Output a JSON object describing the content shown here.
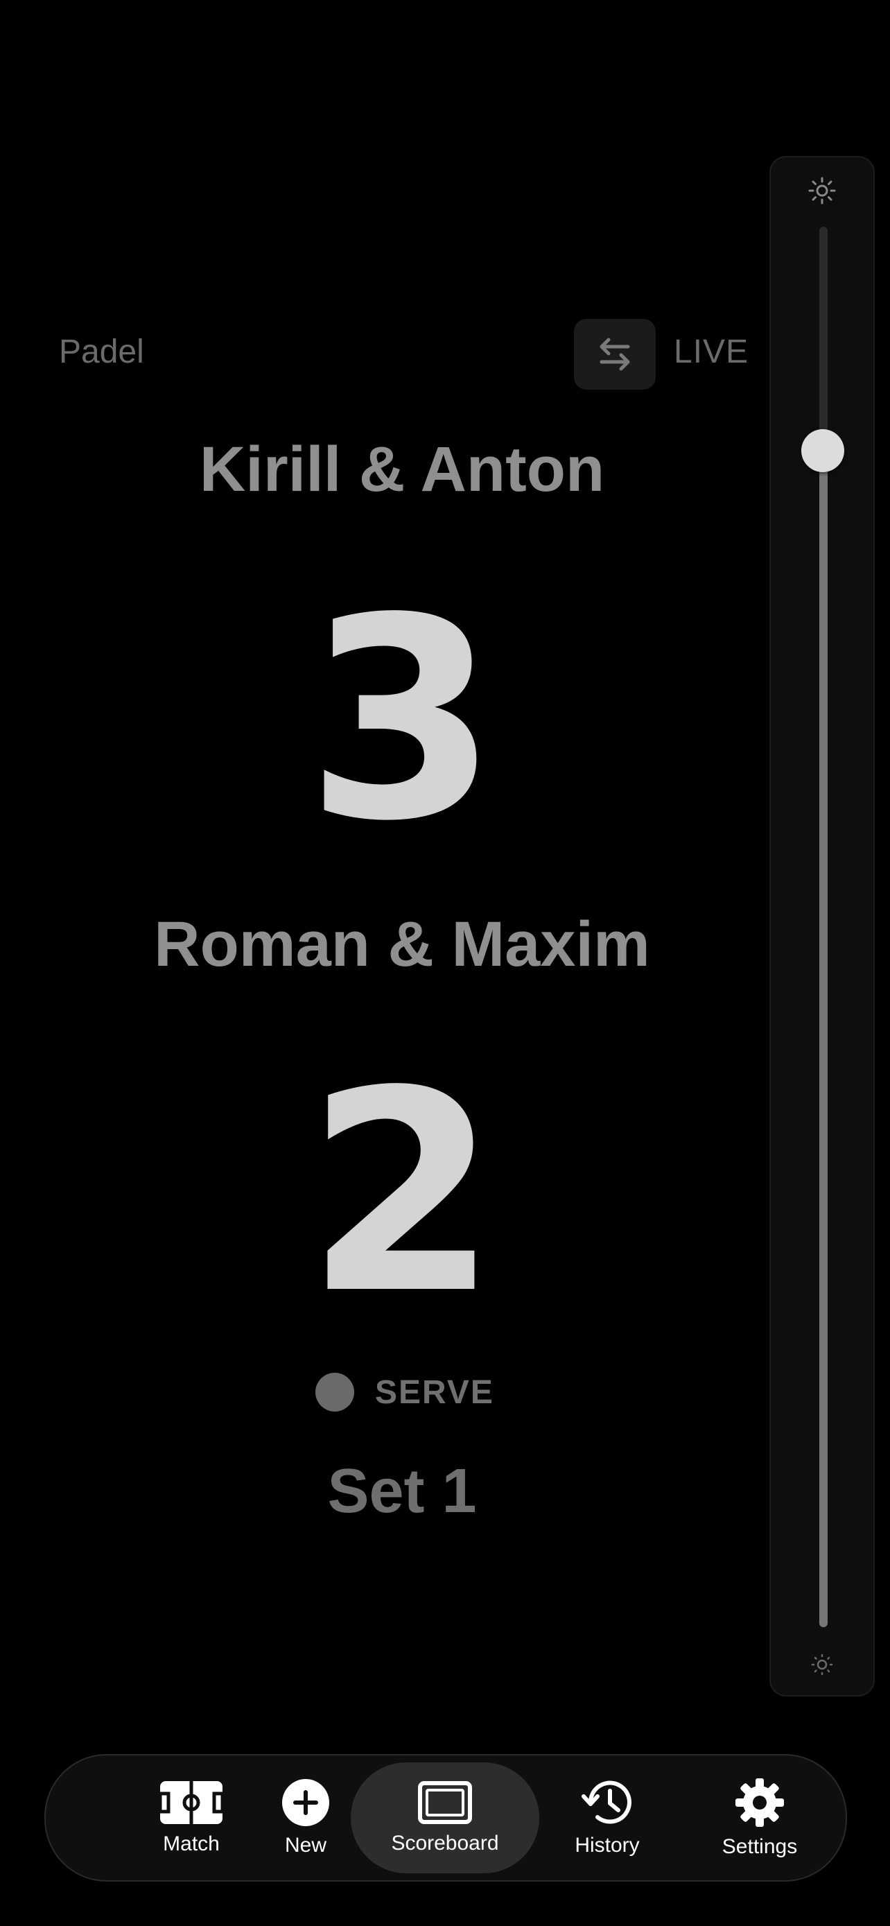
{
  "scoreboard": {
    "sport": "Padel",
    "status": "LIVE",
    "team_a": {
      "name": "Kirill & Anton",
      "score": "3"
    },
    "team_b": {
      "name": "Roman & Maxim",
      "score": "2"
    },
    "serve_label": "SERVE",
    "set_label": "Set 1"
  },
  "brightness": {
    "level": 0.84,
    "icons": [
      "sun-bright-icon",
      "sun-dim-icon"
    ]
  },
  "tab_bar": {
    "active": "Scoreboard",
    "tabs": [
      {
        "label": "Match",
        "icon": "court-icon"
      },
      {
        "label": "New",
        "icon": "plus-circle-icon"
      },
      {
        "label": "Scoreboard",
        "icon": "scoreboard-icon"
      },
      {
        "label": "History",
        "icon": "history-icon"
      },
      {
        "label": "Settings",
        "icon": "gear-icon"
      }
    ]
  },
  "colors": {
    "background": "#000000",
    "score": "#d4d4d4",
    "team_name": "#8f8f8f",
    "muted": "#6b6b6b"
  }
}
